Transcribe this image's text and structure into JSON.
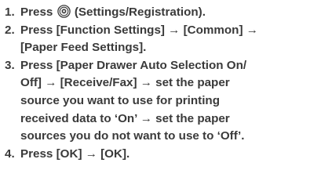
{
  "steps": [
    {
      "number": "1.",
      "prefix": "Press",
      "icon": "settings-registration-icon",
      "suffix": "(Settings/Registration)."
    },
    {
      "number": "2.",
      "line1": "Press [Function Settings] → [Common] →",
      "line2": "[Paper Feed Settings]."
    },
    {
      "number": "3.",
      "line1": "Press [Paper Drawer Auto Selection On/",
      "line2": "Off] → [Receive/Fax] → set the paper",
      "line3": "source you want to use for printing",
      "line4": "received data to ‘On’ → set the paper",
      "line5": "sources you do not want to use to ‘Off’."
    },
    {
      "number": "4.",
      "text": "Press [OK] → [OK]."
    }
  ]
}
